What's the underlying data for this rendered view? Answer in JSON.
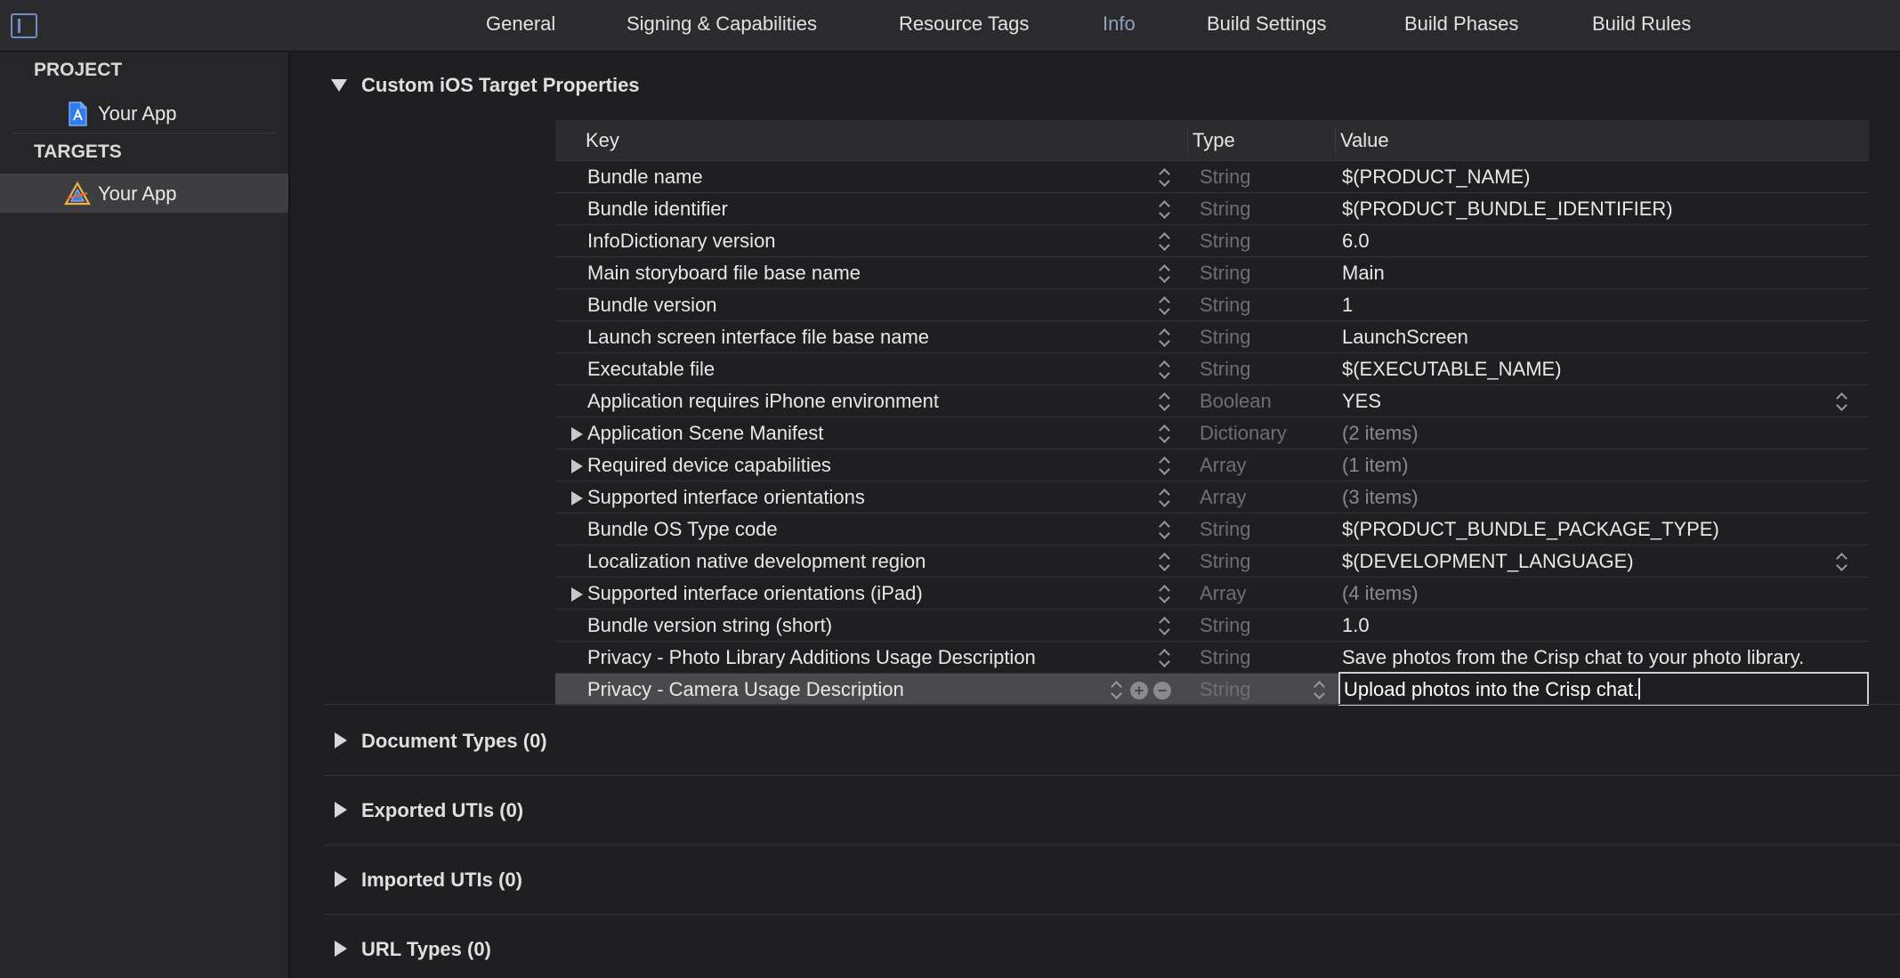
{
  "tabs": [
    {
      "label": "General",
      "active": false
    },
    {
      "label": "Signing & Capabilities",
      "active": false
    },
    {
      "label": "Resource Tags",
      "active": false
    },
    {
      "label": "Info",
      "active": true
    },
    {
      "label": "Build Settings",
      "active": false
    },
    {
      "label": "Build Phases",
      "active": false
    },
    {
      "label": "Build Rules",
      "active": false
    }
  ],
  "sidebar": {
    "project_heading": "PROJECT",
    "project_item": "Your App",
    "targets_heading": "TARGETS",
    "target_item": "Your App"
  },
  "sections": {
    "custom_properties": "Custom iOS Target Properties",
    "document_types": "Document Types (0)",
    "exported_utis": "Exported UTIs (0)",
    "imported_utis": "Imported UTIs (0)",
    "url_types": "URL Types (0)"
  },
  "table": {
    "headers": {
      "key": "Key",
      "type": "Type",
      "value": "Value"
    },
    "rows": [
      {
        "key": "Bundle name",
        "type": "String",
        "value": "$(PRODUCT_NAME)"
      },
      {
        "key": "Bundle identifier",
        "type": "String",
        "value": "$(PRODUCT_BUNDLE_IDENTIFIER)"
      },
      {
        "key": "InfoDictionary version",
        "type": "String",
        "value": "6.0"
      },
      {
        "key": "Main storyboard file base name",
        "type": "String",
        "value": "Main"
      },
      {
        "key": "Bundle version",
        "type": "String",
        "value": "1"
      },
      {
        "key": "Launch screen interface file base name",
        "type": "String",
        "value": "LaunchScreen"
      },
      {
        "key": "Executable file",
        "type": "String",
        "value": "$(EXECUTABLE_NAME)"
      },
      {
        "key": "Application requires iPhone environment",
        "type": "Boolean",
        "value": "YES"
      },
      {
        "key": "Application Scene Manifest",
        "type": "Dictionary",
        "value": "(2 items)"
      },
      {
        "key": "Required device capabilities",
        "type": "Array",
        "value": "(1 item)"
      },
      {
        "key": "Supported interface orientations",
        "type": "Array",
        "value": "(3 items)"
      },
      {
        "key": "Bundle OS Type code",
        "type": "String",
        "value": "$(PRODUCT_BUNDLE_PACKAGE_TYPE)"
      },
      {
        "key": "Localization native development region",
        "type": "String",
        "value": "$(DEVELOPMENT_LANGUAGE)"
      },
      {
        "key": "Supported interface orientations (iPad)",
        "type": "Array",
        "value": "(4 items)"
      },
      {
        "key": "Bundle version string (short)",
        "type": "String",
        "value": "1.0"
      },
      {
        "key": "Privacy - Photo Library Additions Usage Description",
        "type": "String",
        "value": "Save photos from the Crisp chat to your photo library."
      },
      {
        "key": "Privacy - Camera Usage Description",
        "type": "String",
        "value": "Upload photos into the Crisp chat."
      }
    ]
  },
  "icons": {
    "sidebar_toggle": "sidebar-toggle-icon",
    "project": "xcodeproj-icon",
    "target": "app-target-icon",
    "add": "plus-circle-icon",
    "remove": "minus-circle-icon"
  },
  "colors": {
    "background": "#1f1f21",
    "sidebar": "#262628",
    "topbar": "#2b2b2d",
    "active_tab": "#8ea3c4",
    "selected_row": "#4a4a4d"
  }
}
